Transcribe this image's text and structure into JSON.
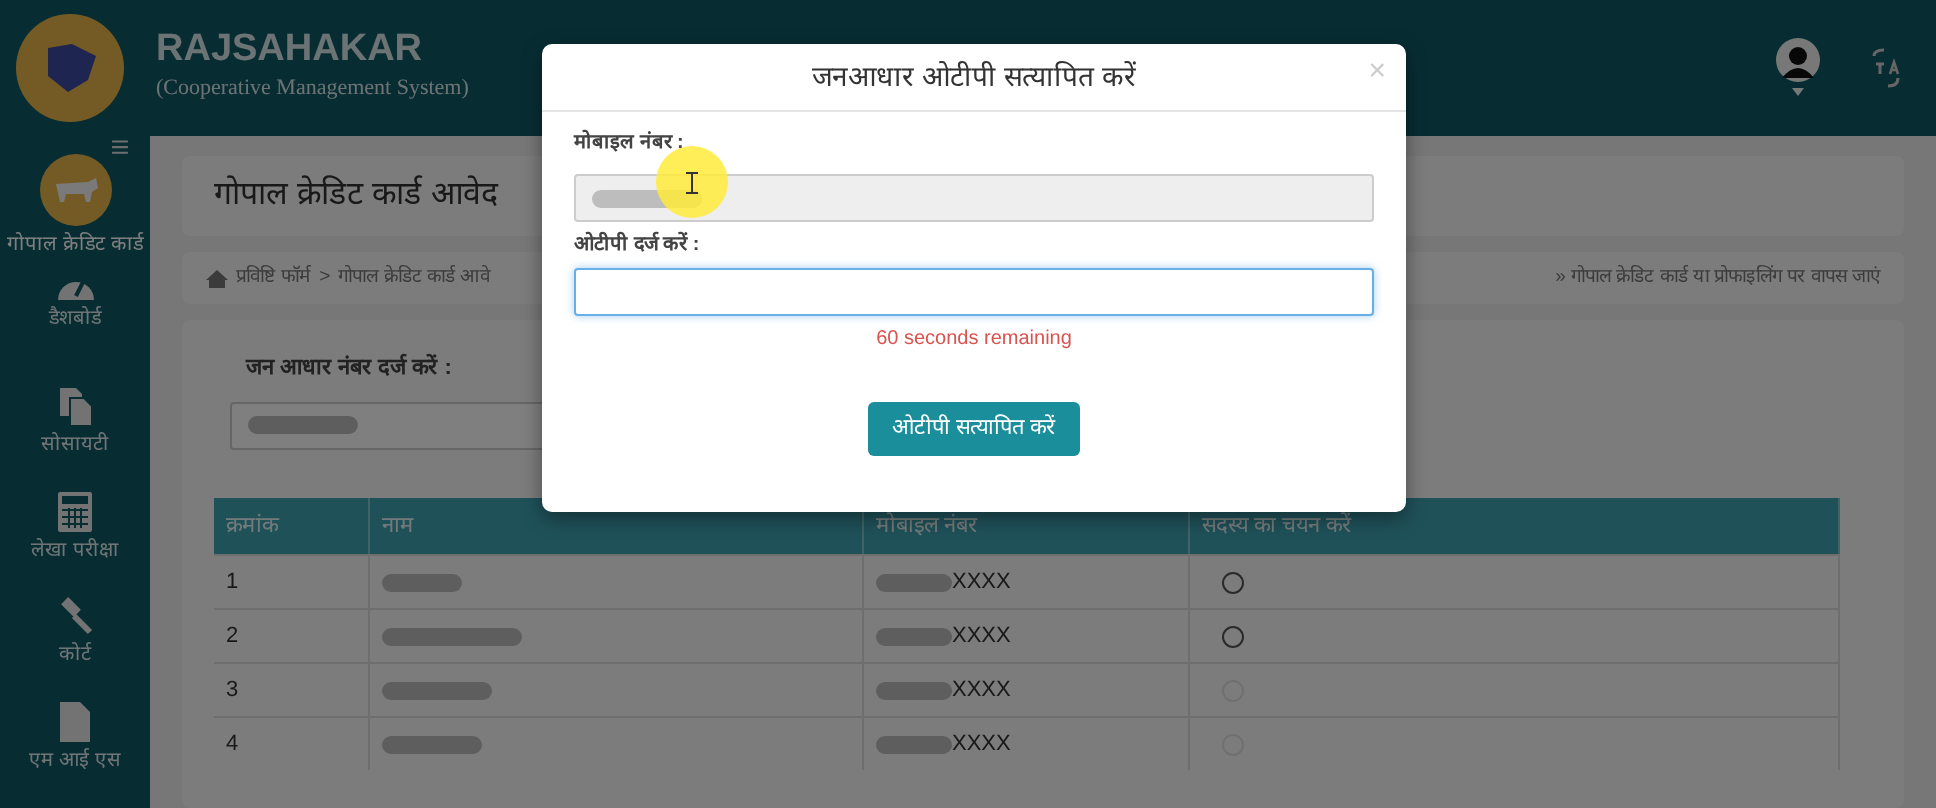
{
  "header": {
    "title": "RAJSAHAKAR",
    "subtitle": "(Cooperative Management System)"
  },
  "sidebar": {
    "items": [
      {
        "label": "गोपाल क्रेडिट कार्ड",
        "selected": true
      },
      {
        "label": "डैशबोर्ड",
        "selected": false
      },
      {
        "label": "सोसायटी",
        "selected": false
      },
      {
        "label": "लेखा परीक्षा",
        "selected": false
      },
      {
        "label": "कोर्ट",
        "selected": false
      },
      {
        "label": "एम आई एस",
        "selected": false
      }
    ]
  },
  "page": {
    "title": "गोपाल क्रेडिट कार्ड आवेद",
    "breadcrumb": [
      "प्रविष्टि फॉर्म",
      "गोपाल क्रेडिट कार्ड आवे"
    ],
    "separator": ">",
    "back_link": "» गोपाल क्रेडिट कार्ड या प्रोफाइलिंग पर वापस जाएं",
    "jan_aadhar_label": "जन आधार नंबर दर्ज करें :"
  },
  "table": {
    "columns": [
      "क्रमांक",
      "नाम",
      "मोबाइल नंबर",
      "सदस्य का चयन करें"
    ],
    "rows": [
      {
        "number": "1",
        "mobile_suffix": "XXXX",
        "selected": false,
        "disabled": false
      },
      {
        "number": "2",
        "mobile_suffix": "XXXX",
        "selected": false,
        "disabled": false
      },
      {
        "number": "3",
        "mobile_suffix": "XXXX",
        "selected": false,
        "disabled": true
      },
      {
        "number": "4",
        "mobile_suffix": "XXXX",
        "selected": false,
        "disabled": true
      }
    ]
  },
  "modal": {
    "title": "जनआधार ओटीपी सत्यापित करें",
    "close": "×",
    "mobile_label": "मोबाइल नंबर :",
    "otp_label": "ओटीपी दर्ज करें :",
    "otp_focused": true,
    "timer": "60 seconds remaining",
    "button": "ओटीपी सत्यापित करें"
  }
}
